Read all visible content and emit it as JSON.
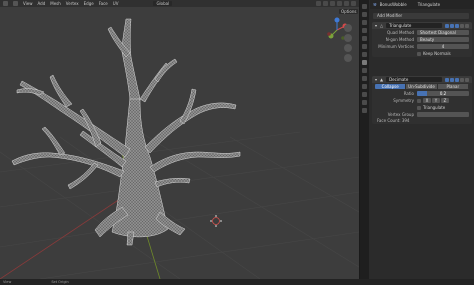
{
  "viewport_header": {
    "menus": [
      "View",
      "Add",
      "Mesh",
      "Vertex",
      "Edge",
      "Face",
      "UV"
    ],
    "orientation": "Global",
    "options_label": "Options"
  },
  "status_bar": {
    "left": "View",
    "right": "Set Origin"
  },
  "properties": {
    "object_name": "BonusWobble",
    "modifier_name": "Triangulate",
    "add_modifier": "Add Modifier",
    "triangulate": {
      "name": "Triangulate",
      "quad_method_label": "Quad Method",
      "quad_method": "Shortest Diagonal",
      "ngon_method_label": "N-gon Method",
      "ngon_method": "Beauty",
      "min_vertices_label": "Minimum Vertices",
      "min_vertices": "4",
      "keep_normals": "Keep Normals"
    },
    "decimate": {
      "name": "Decimate",
      "modes": [
        "Collapse",
        "Un-Subdivide",
        "Planar"
      ],
      "active_mode": 0,
      "ratio_label": "Ratio",
      "ratio": "0.2",
      "ratio_fraction": 0.2,
      "symmetry_label": "Symmetry",
      "symmetry_axes": [
        "X",
        "Y",
        "Z"
      ],
      "triangulate_label": "Triangulate",
      "vertex_group_label": "Vertex Group",
      "face_count": "Face Count: 394"
    }
  },
  "colors": {
    "accent": "#4772b3",
    "viewport_bg": "#3d3d3d",
    "panel_bg": "#2b2b2b"
  }
}
